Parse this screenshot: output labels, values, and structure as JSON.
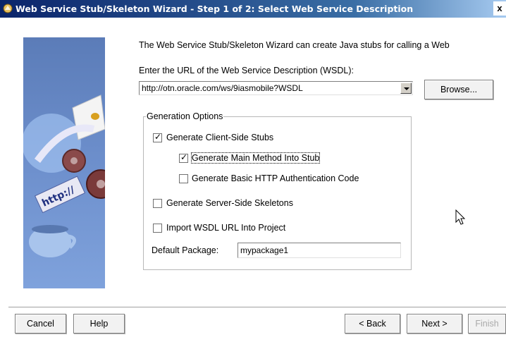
{
  "window": {
    "title": "Web Service Stub/Skeleton Wizard - Step 1 of 2: Select Web Service Description",
    "close_label": "x"
  },
  "banner": {
    "http_text": "http://"
  },
  "intro_text": "The Web Service Stub/Skeleton Wizard can create Java stubs for calling a Web",
  "wsdl": {
    "label": "Enter the URL of the Web Service Description (WSDL):",
    "value": "http://otn.oracle.com/ws/9iasmobile?WSDL",
    "browse_label": "Browse..."
  },
  "options": {
    "group_title": "Generation Options",
    "client_stubs": {
      "label": "Generate Client-Side Stubs",
      "checked": true
    },
    "main_method": {
      "label": "Generate Main Method Into Stub",
      "checked": true
    },
    "basic_auth": {
      "label": "Generate Basic HTTP Authentication Code",
      "checked": false
    },
    "server_skeletons": {
      "label": "Generate Server-Side Skeletons",
      "checked": false
    },
    "import_wsdl": {
      "label": "Import WSDL URL Into Project",
      "checked": false
    },
    "package_label": "Default Package:",
    "package_value": "mypackage1"
  },
  "footer": {
    "cancel": "Cancel",
    "help": "Help",
    "back": "< Back",
    "next": "Next >",
    "finish": "Finish"
  },
  "icons": [
    "wizard-app-icon",
    "close-icon",
    "dropdown-arrow-icon",
    "checkmark-icon",
    "mouse-cursor-icon"
  ]
}
